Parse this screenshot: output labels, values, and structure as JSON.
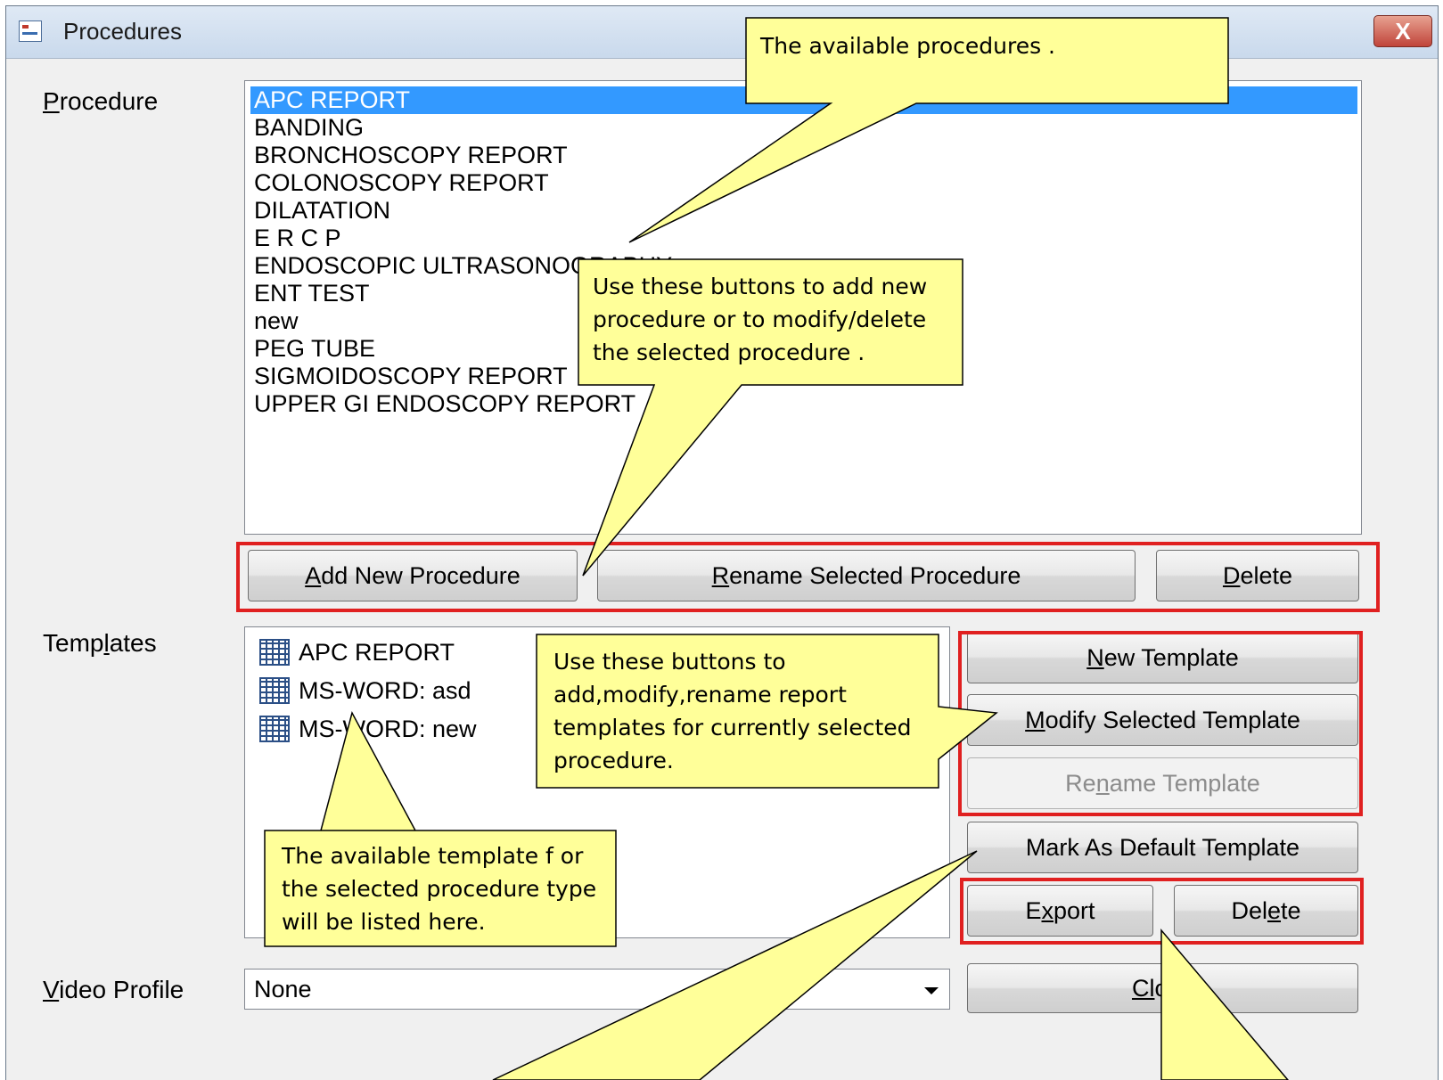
{
  "window": {
    "title": "Procedures",
    "close_glyph": "X"
  },
  "procedure": {
    "label_underlined": "P",
    "label_rest": "rocedure",
    "items": [
      "APC REPORT",
      "BANDING",
      "BRONCHOSCOPY REPORT",
      "COLONOSCOPY REPORT",
      "DILATATION",
      "E R C P",
      "ENDOSCOPIC ULTRASONOGRAPHY",
      "ENT TEST",
      "new",
      "PEG TUBE",
      "SIGMOIDOSCOPY REPORT",
      "UPPER GI ENDOSCOPY REPORT"
    ],
    "selected_index": 0,
    "add_button": {
      "u": "A",
      "rest": "dd New Procedure"
    },
    "rename_button": {
      "u": "R",
      "rest": "ename Selected Procedure"
    },
    "delete_button": {
      "u": "D",
      "rest": "elete"
    }
  },
  "templates": {
    "label_pre": "Temp",
    "label_underlined": "l",
    "label_rest": "ates",
    "items": [
      "APC REPORT",
      "MS-WORD: asd",
      "MS-WORD: new"
    ],
    "new_button": {
      "u": "N",
      "rest": "ew Template"
    },
    "modify_button": {
      "u": "M",
      "rest": "odify Selected Template"
    },
    "rename_button": {
      "pre": "Re",
      "u": "n",
      "rest": "ame Template"
    },
    "default_button": "Mark As Default Template",
    "export_button": {
      "pre": "E",
      "u": "x",
      "rest": "port"
    },
    "delete_button": {
      "pre": "Del",
      "u": "e",
      "rest": "te"
    }
  },
  "video_profile": {
    "label_underlined": "V",
    "label_rest": "ideo Profile",
    "value": "None"
  },
  "close_button": {
    "u": "Cl",
    "rest": "ose"
  },
  "callouts": {
    "procedures": "The available procedures .",
    "procedure_buttons": [
      "Use these buttons to add new",
      "procedure or to modify/delete",
      "the selected  procedure ."
    ],
    "template_buttons": [
      "Use these buttons to",
      "add,modify,rename  report",
      "templates for currently selected",
      "procedure."
    ],
    "templates_list": [
      "The available template f or",
      "the selected procedure type",
      "will be listed here."
    ]
  },
  "colors": {
    "selection": "#3399ff",
    "callout_fill": "#ffff99",
    "highlight_box": "#e02020"
  }
}
